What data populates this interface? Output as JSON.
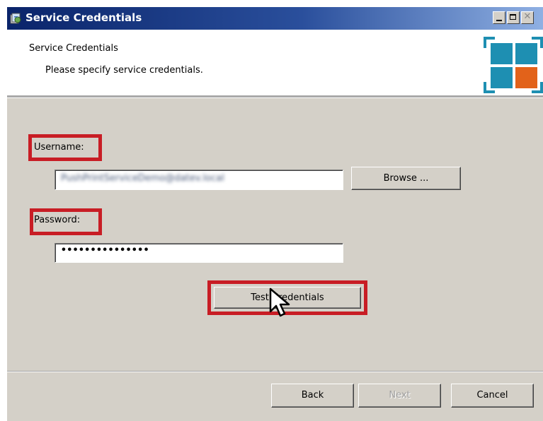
{
  "window": {
    "title": "Service Credentials"
  },
  "header": {
    "title": "Service Credentials",
    "subtitle": "Please specify service credentials.",
    "logo_colors": [
      "#1e8fb2",
      "#1e8fb2",
      "#1e8fb2",
      "#e2621a"
    ]
  },
  "form": {
    "username_label": "Username:",
    "username_value": "PushPrintServiceDemo@datev.local",
    "browse_label": "Browse ...",
    "password_label": "Password:",
    "password_value": "•••••••••••••••",
    "test_button_label": "Test Credentials"
  },
  "footer": {
    "back_label": "Back",
    "next_label": "Next",
    "cancel_label": "Cancel"
  },
  "colors": {
    "highlight": "#c81d25",
    "titlebar": "#0a246a",
    "dialog_background": "#d4d0c8"
  }
}
